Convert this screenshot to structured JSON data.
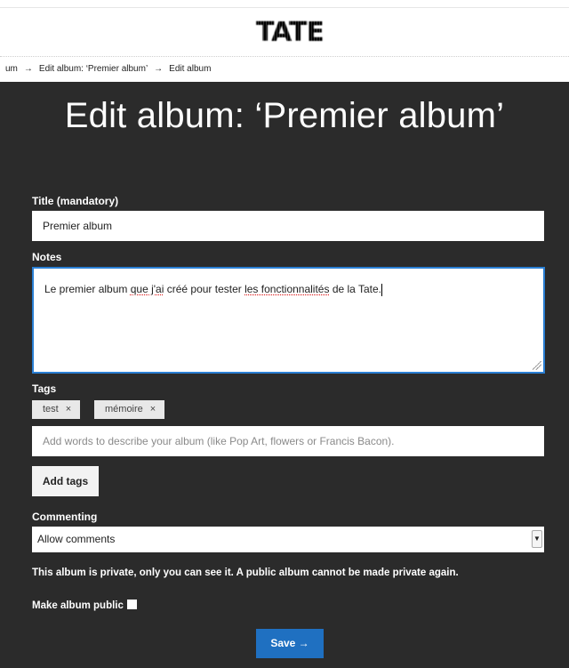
{
  "header": {
    "logo_text": "TATE"
  },
  "breadcrumb": {
    "items": [
      "um",
      "Edit album: ‘Premier album’",
      "Edit album"
    ],
    "separator": "→"
  },
  "page_title": "Edit album: ‘Premier album’",
  "form": {
    "title_label": "Title (mandatory)",
    "title_value": "Premier album",
    "notes_label": "Notes",
    "notes_value": {
      "part1": "Le premier album ",
      "spell1": "que j'ai",
      "part2": " ",
      "spell2": "créé",
      "part3": " pour tester ",
      "spell3": "les fonctionnalités",
      "part4": " de la Tate."
    },
    "tags_label": "Tags",
    "tags": [
      "test",
      "mémoire"
    ],
    "tag_remove_icon": "×",
    "tags_input_placeholder": "Add words to describe your album (like Pop Art, flowers or Francis Bacon).",
    "add_tags_label": "Add tags",
    "commenting_label": "Commenting",
    "commenting_value": "Allow comments",
    "privacy_text": "This album is private, only you can see it. A public album cannot be made private again.",
    "make_public_label": "Make album public",
    "save_label": "Save →"
  },
  "colors": {
    "panel_bg": "#2b2b2b",
    "accent": "#1f70c1",
    "focus": "#2a7fd4"
  }
}
